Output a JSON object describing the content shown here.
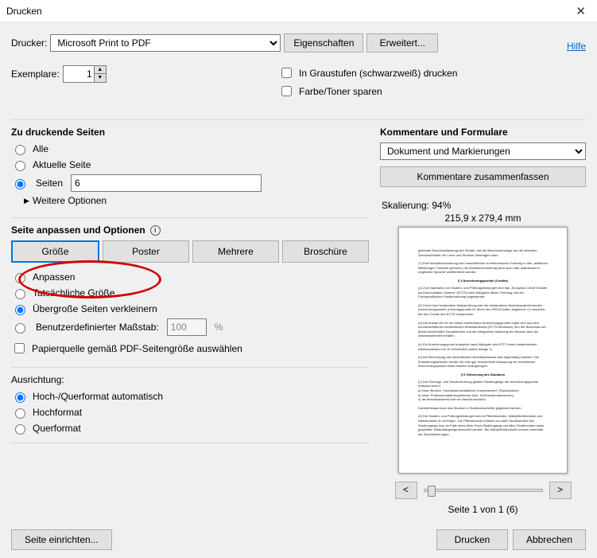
{
  "window": {
    "title": "Drucken"
  },
  "help_link": "Hilfe",
  "printer": {
    "label": "Drucker:",
    "selected": "Microsoft Print to PDF",
    "properties_btn": "Eigenschaften",
    "advanced_btn": "Erweitert..."
  },
  "copies": {
    "label": "Exemplare:",
    "value": "1"
  },
  "options_top": {
    "grayscale": "In Graustufen (schwarzweiß) drucken",
    "save_toner": "Farbe/Toner sparen"
  },
  "pages_to_print": {
    "title": "Zu druckende Seiten",
    "opt_all": "Alle",
    "opt_current": "Aktuelle Seite",
    "opt_pages": "Seiten",
    "pages_value": "6",
    "more_options": "Weitere Optionen"
  },
  "sizing": {
    "title": "Seite anpassen und Optionen",
    "btn_size": "Größe",
    "btn_poster": "Poster",
    "btn_multiple": "Mehrere",
    "btn_booklet": "Broschüre",
    "opt_fit": "Anpassen",
    "opt_actual": "Tatsächliche Größe",
    "opt_shrink": "Übergroße Seiten verkleinern",
    "opt_custom": "Benutzerdefinierter Maßstab:",
    "custom_value": "100",
    "custom_unit": "%",
    "paper_source": "Papierquelle gemäß PDF-Seitengröße auswählen"
  },
  "orientation": {
    "title": "Ausrichtung:",
    "opt_auto": "Hoch-/Querformat automatisch",
    "opt_portrait": "Hochformat",
    "opt_landscape": "Querformat"
  },
  "comments": {
    "title": "Kommentare und Formulare",
    "selected": "Dokument und Markierungen",
    "summarize_btn": "Kommentare zusammenfassen"
  },
  "preview": {
    "scale_label": "Skalierung:  94%",
    "dims": "215,9 x 279,4 mm",
    "page_counter": "Seite 1 von 1 (6)"
  },
  "footer": {
    "page_setup": "Seite einrichten...",
    "print": "Drucken",
    "cancel": "Abbrechen"
  }
}
